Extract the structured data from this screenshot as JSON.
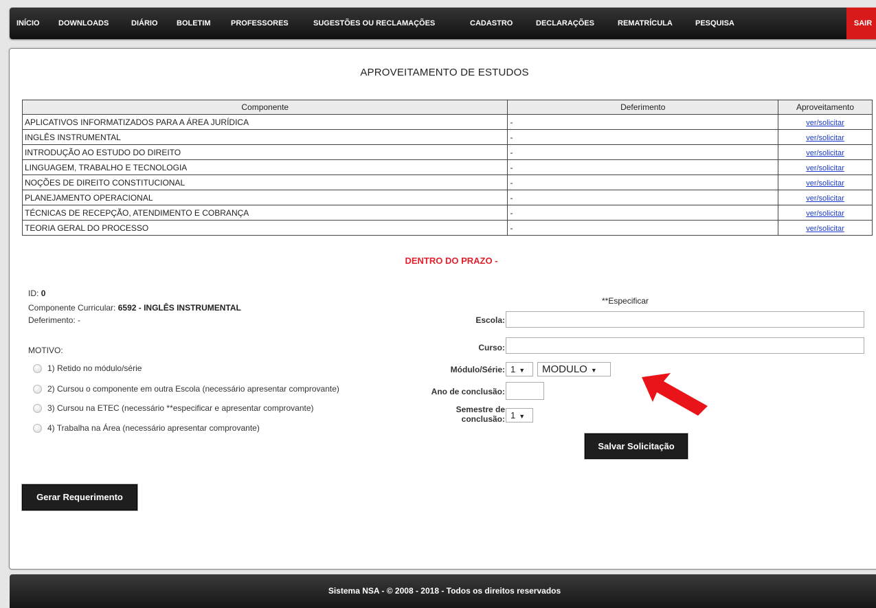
{
  "nav": {
    "items": [
      "INÍCIO",
      "DOWNLOADS",
      "DIÁRIO",
      "BOLETIM",
      "PROFESSORES",
      "SUGESTÕES OU RECLAMAÇÕES",
      "CADASTRO",
      "DECLARAÇÕES",
      "REMATRÍCULA",
      "PESQUISA"
    ],
    "logout": "SAIR"
  },
  "page": {
    "title": "APROVEITAMENTO DE ESTUDOS"
  },
  "table": {
    "headers": [
      "Componente",
      "Deferimento",
      "Aproveitamento"
    ],
    "rows": [
      {
        "componente": "APLICATIVOS INFORMATIZADOS PARA A ÁREA JURÍDICA",
        "deferimento": "-",
        "link": "ver/solicitar"
      },
      {
        "componente": "INGLÊS INSTRUMENTAL",
        "deferimento": "-",
        "link": "ver/solicitar"
      },
      {
        "componente": "INTRODUÇÃO AO ESTUDO DO DIREITO",
        "deferimento": "-",
        "link": "ver/solicitar"
      },
      {
        "componente": "LINGUAGEM, TRABALHO E TECNOLOGIA",
        "deferimento": "-",
        "link": "ver/solicitar"
      },
      {
        "componente": "NOÇÕES DE DIREITO CONSTITUCIONAL",
        "deferimento": "-",
        "link": "ver/solicitar"
      },
      {
        "componente": "PLANEJAMENTO OPERACIONAL",
        "deferimento": "-",
        "link": "ver/solicitar"
      },
      {
        "componente": "TÉCNICAS DE RECEPÇÃO, ATENDIMENTO E COBRANÇA",
        "deferimento": "-",
        "link": "ver/solicitar"
      },
      {
        "componente": "TEORIA GERAL DO PROCESSO",
        "deferimento": "-",
        "link": "ver/solicitar"
      }
    ]
  },
  "status": {
    "text": "DENTRO DO PRAZO -"
  },
  "details": {
    "id_label": "ID:",
    "id_value": "0",
    "component_label": "Componente Curricular:",
    "component_value": "6592  - INGLÊS INSTRUMENTAL",
    "deferimento_label": "Deferimento:",
    "deferimento_value": "-"
  },
  "motivo": {
    "title": "MOTIVO:",
    "options": [
      "1) Retido no módulo/série",
      "2) Cursou o componente em outra Escola (necessário apresentar comprovante)",
      "3) Cursou na ETEC (necessário **especificar e apresentar comprovante)",
      "4) Trabalha na Área (necessário apresentar comprovante)"
    ]
  },
  "form": {
    "especificar": "**Especificar",
    "escola_label": "Escola:",
    "escola_value": "",
    "curso_label": "Curso:",
    "curso_value": "",
    "modulo_label": "Módulo/Série:",
    "modulo_number": "1",
    "modulo_type": "MODULO",
    "ano_label": "Ano de conclusão:",
    "ano_value": "",
    "semestre_label_1": "Semestre de",
    "semestre_label_2": "conclusão:",
    "semestre_value": "1",
    "save_button": "Salvar Solicitação"
  },
  "gerar_button": "Gerar Requerimento",
  "footer": {
    "text": "Sistema NSA  -  © 2008 - 2018  -  Todos os direitos reservados"
  },
  "colors": {
    "accent_red": "#d81a1a",
    "link": "#1a39c8",
    "status_red": "#e0202c",
    "arrow": "#e8141a"
  },
  "icons": {
    "annotation": "arrow-icon",
    "dropdown": "caret-down-icon",
    "radio": "radio-icon"
  }
}
